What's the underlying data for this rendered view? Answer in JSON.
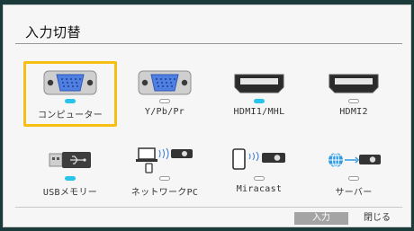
{
  "dialog": {
    "title": "入力切替",
    "inputs": [
      {
        "label": "コンピューター",
        "icon": "vga-port-icon",
        "active": true,
        "selected": true
      },
      {
        "label": "Y/Pb/Pr",
        "icon": "vga-port-icon",
        "active": false,
        "selected": false
      },
      {
        "label": "HDMI1/MHL",
        "icon": "hdmi-port-icon",
        "active": true,
        "selected": false
      },
      {
        "label": "HDMI2",
        "icon": "hdmi-port-icon",
        "active": false,
        "selected": false
      },
      {
        "label": "USBメモリー",
        "icon": "usb-stick-icon",
        "active": true,
        "selected": false
      },
      {
        "label": "ネットワークPC",
        "icon": "network-pc-icon",
        "active": false,
        "selected": false
      },
      {
        "label": "Miracast",
        "icon": "miracast-icon",
        "active": false,
        "selected": false
      },
      {
        "label": "サーバー",
        "icon": "server-icon",
        "active": false,
        "selected": false
      }
    ],
    "footer": {
      "input_label": "入力",
      "close_label": "閉じる"
    }
  },
  "colors": {
    "background": "#1a3b3a",
    "selection_border": "#f7be14",
    "active_indicator": "#29c4ea",
    "vga_blue": "#4f7fe0"
  }
}
